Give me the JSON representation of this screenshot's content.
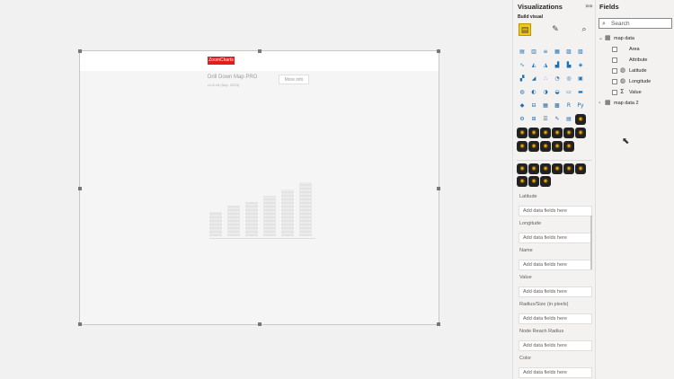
{
  "visual": {
    "logo_text": "ZoomCharts",
    "title": "Drill Down Map PRO",
    "version": "v1.8.18 (Sep, 2023)",
    "more_info": "More info",
    "placeholder_bars": [
      28,
      36,
      40,
      47,
      55,
      63
    ]
  },
  "visualizations": {
    "title": "Visualizations",
    "build_visual": "Build visual",
    "icon_rows": [
      [
        "stacked-bar",
        "stacked-column",
        "clustered-bar",
        "clustered-column",
        "100-bar",
        "100-column"
      ],
      [
        "line",
        "area",
        "stacked-area",
        "line-column",
        "line-clustered",
        "ribbon"
      ],
      [
        "waterfall",
        "funnel",
        "scatter",
        "pie",
        "donut",
        "treemap"
      ],
      [
        "map",
        "filled-map",
        "shape-map",
        "gauge",
        "card",
        "multirow-card"
      ],
      [
        "kpi",
        "slicer",
        "table",
        "matrix",
        "r-visual",
        "python-visual"
      ],
      [
        "key-influencers",
        "decomposition",
        "qa",
        "narrative",
        "paginated",
        "zoomcharts-1"
      ],
      [
        "arcgis",
        "zoomcharts-2",
        "zoomcharts-3",
        "zoomcharts-4",
        "zoomcharts-5",
        "zoomcharts-6"
      ],
      [
        "zoomcharts-7",
        "zoomcharts-8",
        "zoomcharts-9",
        "zoomcharts-10",
        "zoomcharts-11"
      ]
    ],
    "more": "···",
    "custom_rows": [
      [
        "zc-a",
        "zc-b",
        "zc-c",
        "zc-d",
        "zc-e",
        "zc-f"
      ],
      [
        "zc-g",
        "zc-h",
        "zc-i"
      ]
    ],
    "wells": [
      {
        "label": "Latitude",
        "placeholder": "Add data fields here"
      },
      {
        "label": "Longitude",
        "placeholder": "Add data fields here"
      },
      {
        "label": "Name",
        "placeholder": "Add data fields here"
      },
      {
        "label": "Value",
        "placeholder": "Add data fields here"
      },
      {
        "label": "Radius/Size (in pixels)",
        "placeholder": "Add data fields here"
      },
      {
        "label": "Node Reach Radius",
        "placeholder": "Add data fields here"
      },
      {
        "label": "Color",
        "placeholder": "Add data fields here"
      }
    ]
  },
  "fields": {
    "title": "Fields",
    "search_placeholder": "Search",
    "tables": [
      {
        "name": "map data",
        "expanded": true,
        "items": [
          "Area",
          "Attribute",
          "Latitude",
          "Longitude",
          "Value"
        ]
      },
      {
        "name": "map data 2",
        "expanded": false,
        "items": []
      }
    ]
  }
}
